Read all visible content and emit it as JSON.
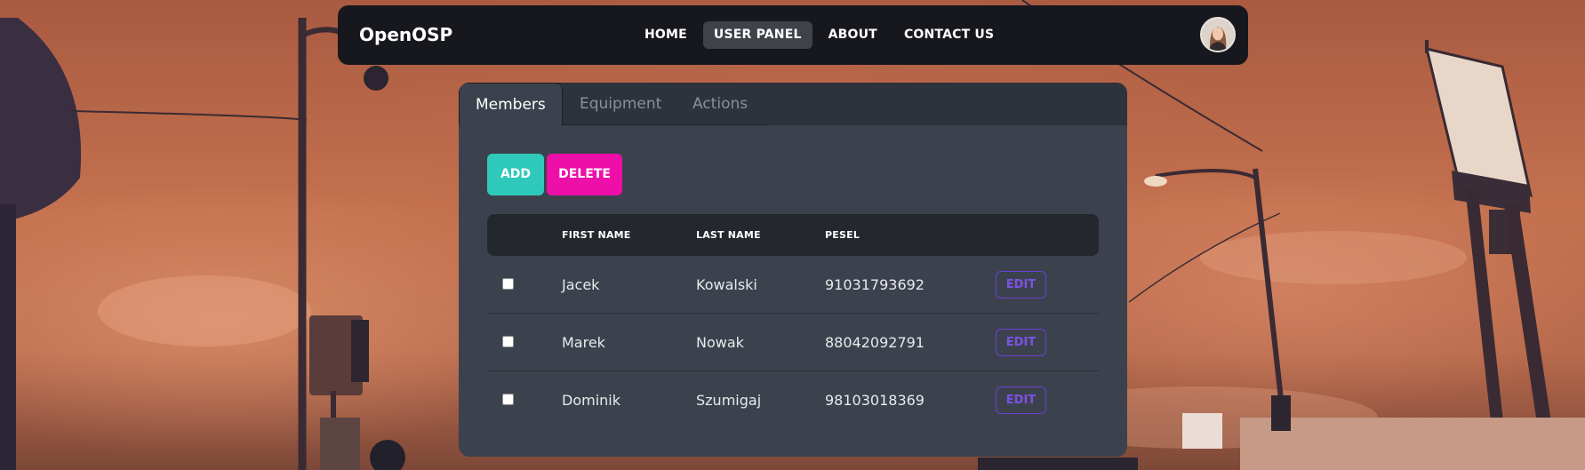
{
  "navbar": {
    "brand": "OpenOSP",
    "links": [
      {
        "label": "HOME",
        "active": false
      },
      {
        "label": "USER PANEL",
        "active": true
      },
      {
        "label": "ABOUT",
        "active": false
      },
      {
        "label": "CONTACT US",
        "active": false
      }
    ],
    "avatar_icon": "user-avatar"
  },
  "tabs": [
    {
      "label": "Members",
      "active": true
    },
    {
      "label": "Equipment",
      "active": false
    },
    {
      "label": "Actions",
      "active": false
    }
  ],
  "toolbar": {
    "add_label": "ADD",
    "delete_label": "DELETE"
  },
  "table": {
    "columns": [
      "FIRST NAME",
      "LAST NAME",
      "PESEL"
    ],
    "rows": [
      {
        "first_name": "Jacek",
        "last_name": "Kowalski",
        "pesel": "91031793692",
        "checked": false,
        "action": "EDIT"
      },
      {
        "first_name": "Marek",
        "last_name": "Nowak",
        "pesel": "88042092791",
        "checked": false,
        "action": "EDIT"
      },
      {
        "first_name": "Dominik",
        "last_name": "Szumigaj",
        "pesel": "98103018369",
        "checked": false,
        "action": "EDIT"
      }
    ]
  },
  "colors": {
    "navbar_bg": "#17181d",
    "panel_bg": "#3c424d",
    "add_button": "#2ec9ba",
    "delete_button": "#ee0fa8",
    "edit_button": "#7d52e6"
  }
}
